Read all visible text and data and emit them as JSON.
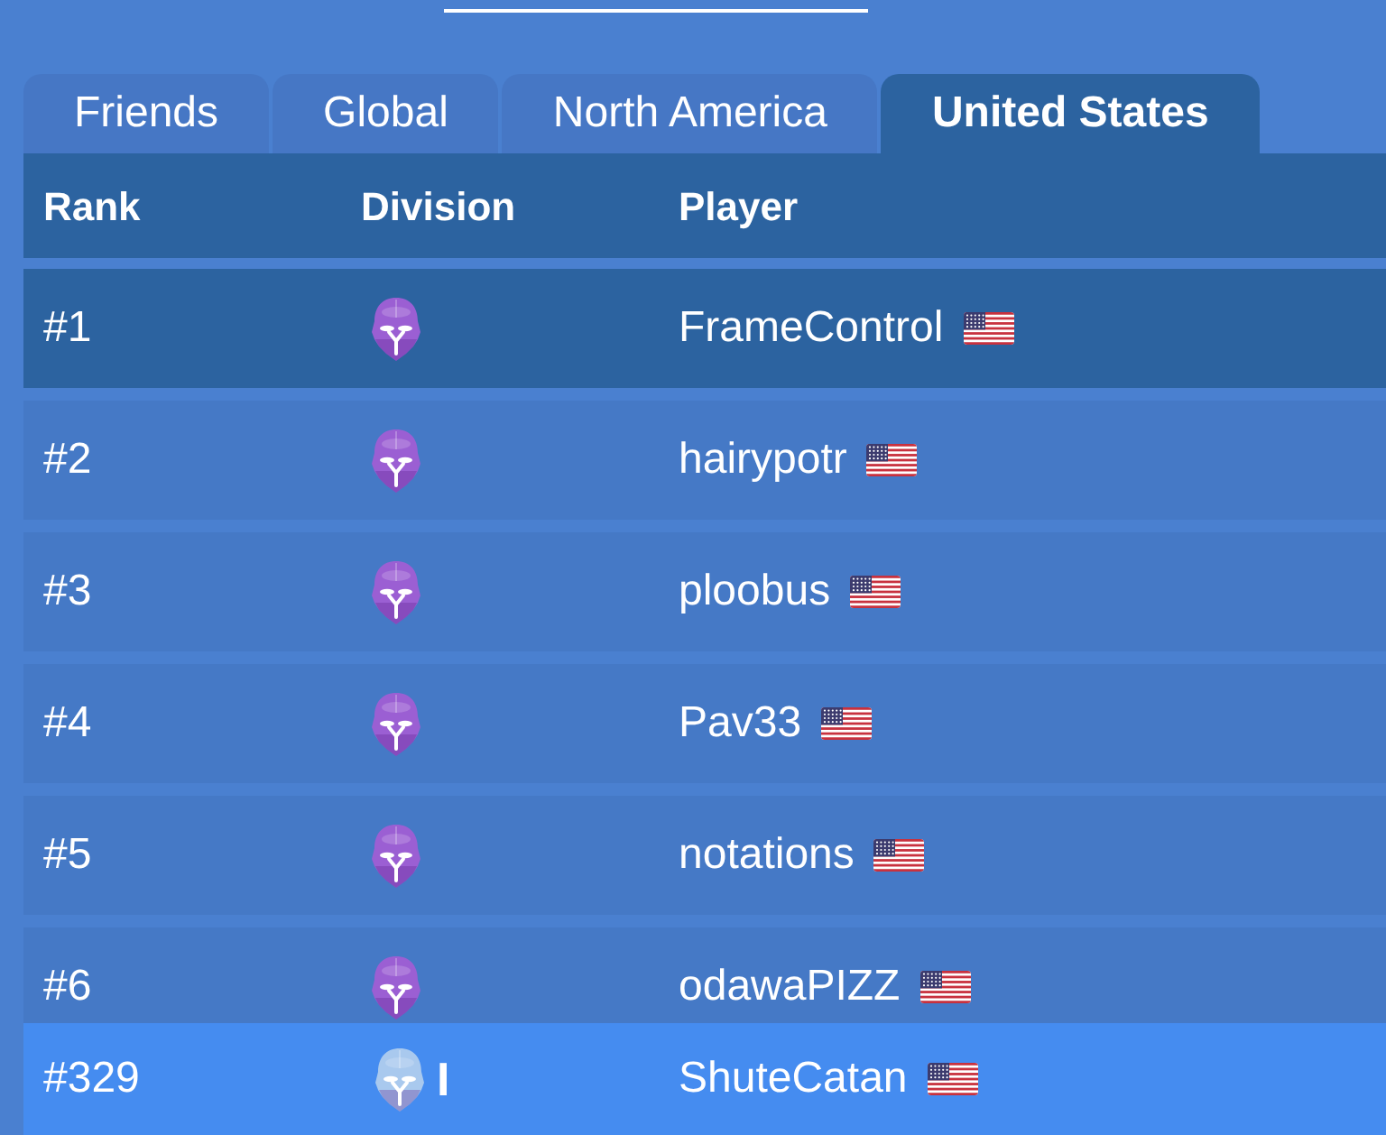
{
  "tabs": [
    {
      "label": "Friends",
      "selected": false
    },
    {
      "label": "Global",
      "selected": false
    },
    {
      "label": "North America",
      "selected": false
    },
    {
      "label": "United States",
      "selected": true
    }
  ],
  "table": {
    "columns": [
      "Rank",
      "Division",
      "Player"
    ],
    "rows": [
      {
        "rank": "#1",
        "division": {
          "color": "#9b5fd3"
        },
        "player": "FrameControl",
        "selected": true
      },
      {
        "rank": "#2",
        "division": {
          "color": "#9b5fd3"
        },
        "player": "hairypotr",
        "selected": false
      },
      {
        "rank": "#3",
        "division": {
          "color": "#9b5fd3"
        },
        "player": "ploobus",
        "selected": false
      },
      {
        "rank": "#4",
        "division": {
          "color": "#9b5fd3"
        },
        "player": "Pav33",
        "selected": false
      },
      {
        "rank": "#5",
        "division": {
          "color": "#9b5fd3"
        },
        "player": "notations",
        "selected": false
      },
      {
        "rank": "#6",
        "division": {
          "color": "#9b5fd3"
        },
        "player": "odawaPIZZ",
        "selected": false
      }
    ]
  },
  "my_rank": {
    "rank": "#329",
    "division": {
      "color": "#a9c9ee",
      "tier": "I"
    },
    "player": "ShuteCatan"
  }
}
